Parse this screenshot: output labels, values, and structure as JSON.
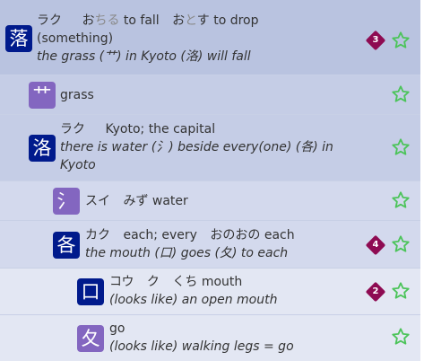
{
  "rows": [
    {
      "kanji": "落",
      "on": "ラク",
      "kun_prefix_1": "お",
      "kun_okurigana_1": "ちる",
      "meaning_1": "to fall",
      "kun_prefix_2": "お",
      "kun_stem_2": "と",
      "kun_okurigana_2": "す",
      "meaning_2a": "to drop",
      "meaning_2b": "(something)",
      "mnemonic": "the grass (艹) in Kyoto (洛) will fall",
      "badge": "3"
    },
    {
      "kanji": "艹",
      "meaning": "grass"
    },
    {
      "kanji": "洛",
      "on": "ラク",
      "meaning": "Kyoto; the capital",
      "mnemonic_1": "there is water (氵) beside every(one) (各) in",
      "mnemonic_2": "Kyoto"
    },
    {
      "kanji": "氵",
      "on": "スイ",
      "kun": "みず",
      "meaning": "water"
    },
    {
      "kanji": "各",
      "on": "カク",
      "meaning": "each; every",
      "kun": "おのおの",
      "meaning_2": "each",
      "mnemonic": "the mouth (口) goes (夂) to each",
      "badge": "4"
    },
    {
      "kanji": "口",
      "on": "コウ",
      "on_2": "ク",
      "kun": "くち",
      "meaning": "mouth",
      "mnemonic": "(looks like) an open mouth",
      "badge": "2"
    },
    {
      "kanji": "夂",
      "meaning": "go",
      "mnemonic": "(looks like) walking legs = go"
    }
  ],
  "colors": {
    "dark_kanji_bg": "#001a8c",
    "purple_kanji_bg": "#8366c0",
    "badge": "#8e0b52",
    "star": "#4cc45a"
  },
  "icons": {
    "favorite": "star-outline-icon",
    "badge": "diamond-count-badge"
  }
}
